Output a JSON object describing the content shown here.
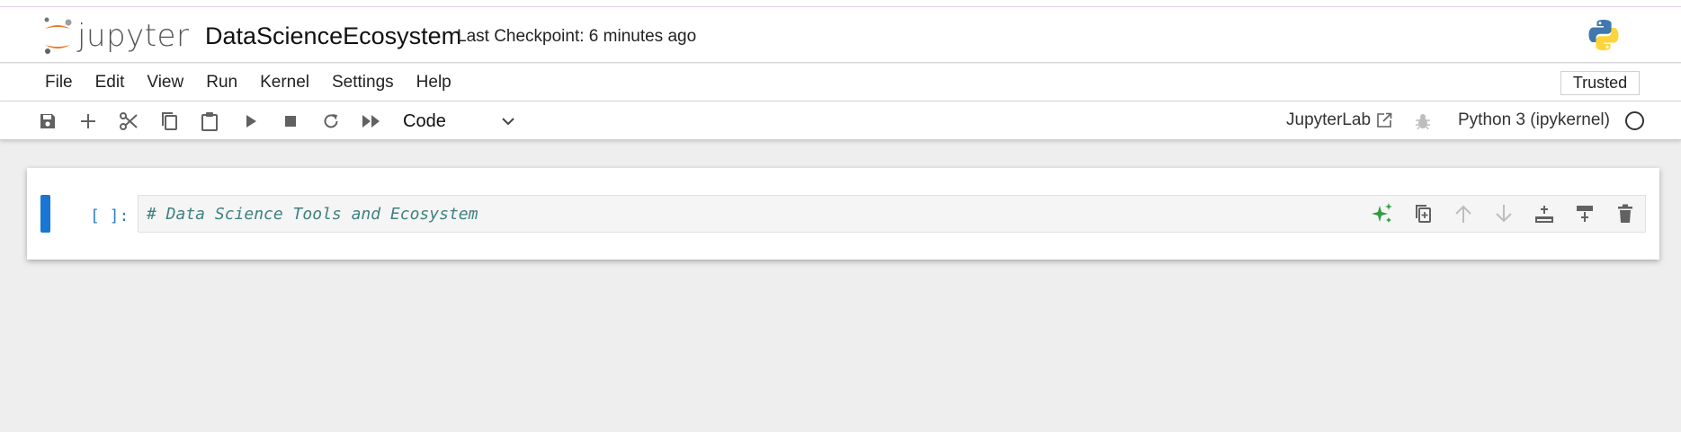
{
  "app": {
    "logo_text": "jupyter",
    "notebook_title": "DataScienceEcosystem",
    "checkpoint": "Last Checkpoint: 6 minutes ago",
    "kernel_logo": "python-logo-icon"
  },
  "menu": {
    "items": [
      "File",
      "Edit",
      "View",
      "Run",
      "Kernel",
      "Settings",
      "Help"
    ],
    "trusted_label": "Trusted"
  },
  "toolbar": {
    "buttons": [
      "save-icon",
      "add-cell-icon",
      "cut-icon",
      "copy-icon",
      "paste-icon",
      "run-icon",
      "stop-icon",
      "restart-icon",
      "run-all-icon"
    ],
    "cell_type": "Code",
    "jupyterlab_label": "JupyterLab",
    "kernel_name": "Python 3 (ipykernel)",
    "kernel_status": "idle"
  },
  "cell": {
    "prompt": "[ ]:",
    "source": "# Data Science Tools and Ecosystem",
    "tools": [
      "ai-sparkle-icon",
      "duplicate-icon",
      "move-up-icon",
      "move-down-icon",
      "insert-above-icon",
      "insert-below-icon",
      "delete-icon"
    ]
  },
  "colors": {
    "accent": "#1976d2",
    "prompt": "#307fc1",
    "comment": "#408080",
    "jupyter_orange": "#f37726",
    "sparkle": "#2e9e44"
  }
}
